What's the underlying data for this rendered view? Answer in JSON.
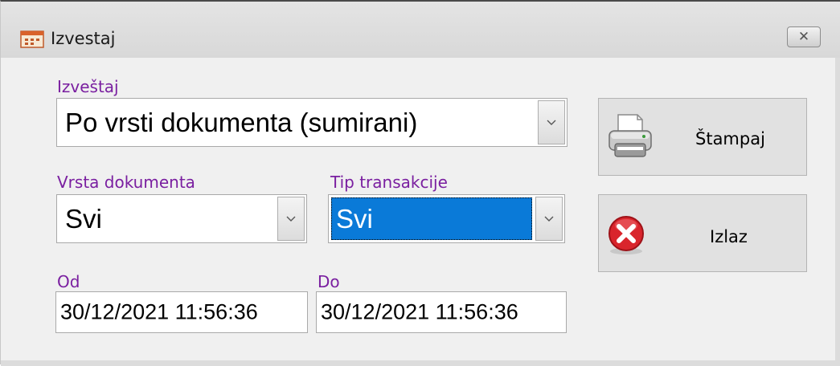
{
  "window": {
    "title": "Izvestaj",
    "close_glyph": "✕"
  },
  "report": {
    "label": "Izveštaj",
    "value": "Po vrsti dokumenta (sumirani)"
  },
  "document_type": {
    "label": "Vrsta dokumenta",
    "value": "Svi"
  },
  "transaction_type": {
    "label": "Tip transakcije",
    "value": "Svi"
  },
  "date_from": {
    "label": "Od",
    "value": "30/12/2021 11:56:36"
  },
  "date_to": {
    "label": "Do",
    "value": "30/12/2021 11:56:36"
  },
  "buttons": {
    "print_label": "Štampaj",
    "print_icon": "printer-icon",
    "exit_label": "Izlaz",
    "exit_icon": "exit-icon"
  },
  "colors": {
    "label_purple": "#7a1fa0",
    "selection_blue": "#0a7ad8",
    "exit_red": "#d9252c"
  }
}
